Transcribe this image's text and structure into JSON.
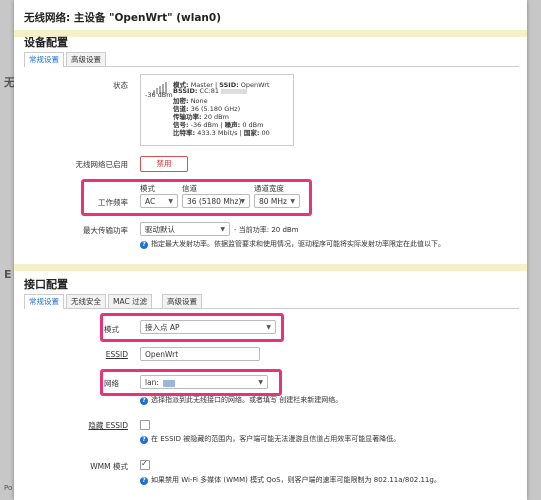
{
  "background": {
    "left_fragments": [
      "无",
      "E"
    ],
    "left_bottom": "Po"
  },
  "modal": {
    "title": "无线网络: 主设备 \"OpenWrt\" (wlan0)"
  },
  "device_config": {
    "title": "设备配置",
    "tabs": [
      "常规设置",
      "高级设置"
    ],
    "status_label": "状态",
    "status": {
      "signal_dbm": "-36 dBm",
      "mode_line_label": "模式:",
      "mode_value": "Master",
      "ssid_label": "SSID:",
      "ssid_value": "OpenWrt",
      "bssid_label": "BSSID:",
      "bssid_value": "CC:81",
      "encryption_label": "加密:",
      "encryption_value": "None",
      "channel_label": "信道:",
      "channel_value": "36 (5.180 GHz)",
      "txpower_label": "传输功率:",
      "txpower_value": "20 dBm",
      "signal_label": "信号:",
      "signal_value": "-36 dBm",
      "noise_label": "噪声:",
      "noise_value": "0 dBm",
      "bitrate_label": "比特率:",
      "bitrate_value": "433.3 Mbit/s",
      "country_label": "国家:",
      "country_value": "00"
    },
    "wireless_enabled_label": "无线网络已启用",
    "disable_button": "禁用",
    "freq_label": "工作频率",
    "freq_headers": [
      "模式",
      "信道",
      "通道宽度"
    ],
    "freq_mode": "AC",
    "freq_channel": "36 (5180 Mhz)",
    "freq_width": "80 MHz",
    "maxpower_label": "最大传输功率",
    "maxpower_value": "驱动默认",
    "maxpower_current": "- 当前功率: 20 dBm",
    "maxpower_hint": "指定最大发射功率。依据监管要求和使用情况，驱动程序可能将实际发射功率限定在此值以下。"
  },
  "interface_config": {
    "title": "接口配置",
    "tabs": [
      "常规设置",
      "无线安全",
      "MAC 过滤",
      "高级设置"
    ],
    "mode_label": "模式",
    "mode_value": "接入点 AP",
    "essid_label": "ESSID",
    "essid_value": "OpenWrt",
    "network_label": "网络",
    "network_value": "lan:",
    "network_hint": "选择指派到此无线接口的网络。或者填写 创建栏来新建网络。",
    "hide_essid_label": "隐藏 ESSID",
    "hide_essid_hint": "在 ESSID 被隐藏的范围内，客户端可能无法漫游且信道占用效率可能显著降低。",
    "wmm_label": "WMM 模式",
    "wmm_hint": "如果禁用 Wi-Fi 多媒体 (WMM) 模式 QoS，则客户端的速率可能限制为 802.11a/802.11g。"
  },
  "colors": {
    "highlight": "#e8337a",
    "accent": "#1a6fd6",
    "danger": "#d03030"
  }
}
